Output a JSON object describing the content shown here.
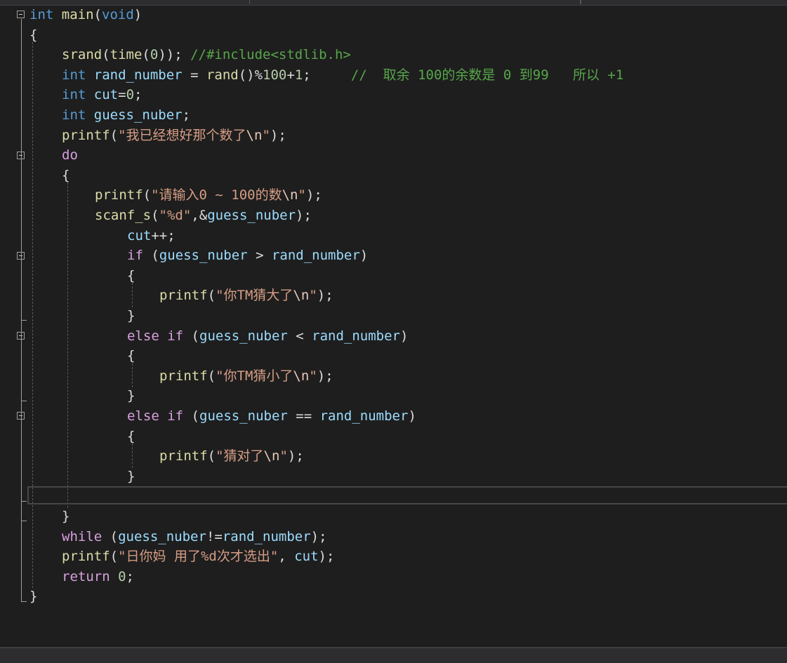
{
  "editor": {
    "lines": [
      [
        {
          "t": "int",
          "c": "kw"
        },
        {
          "t": " "
        },
        {
          "t": "main",
          "c": "fn"
        },
        {
          "t": "("
        },
        {
          "t": "void",
          "c": "kw"
        },
        {
          "t": ")"
        }
      ],
      [
        {
          "t": "{"
        }
      ],
      [
        {
          "t": "srand",
          "c": "fn"
        },
        {
          "t": "("
        },
        {
          "t": "time",
          "c": "fn"
        },
        {
          "t": "("
        },
        {
          "t": "0",
          "c": "num"
        },
        {
          "t": ")); "
        },
        {
          "t": "//#include<stdlib.h>",
          "c": "cmt"
        }
      ],
      [
        {
          "t": "int",
          "c": "kw"
        },
        {
          "t": " "
        },
        {
          "t": "rand_number",
          "c": "var"
        },
        {
          "t": " = "
        },
        {
          "t": "rand",
          "c": "fn"
        },
        {
          "t": "()%"
        },
        {
          "t": "100",
          "c": "num"
        },
        {
          "t": "+"
        },
        {
          "t": "1",
          "c": "num"
        },
        {
          "t": ";     "
        },
        {
          "t": "//  取余 100的余数是 0 到99   所以 +1",
          "c": "cmt"
        }
      ],
      [
        {
          "t": "int",
          "c": "kw"
        },
        {
          "t": " "
        },
        {
          "t": "cut",
          "c": "var"
        },
        {
          "t": "="
        },
        {
          "t": "0",
          "c": "num"
        },
        {
          "t": ";"
        }
      ],
      [
        {
          "t": "int",
          "c": "kw"
        },
        {
          "t": " "
        },
        {
          "t": "guess_nuber",
          "c": "var"
        },
        {
          "t": ";"
        }
      ],
      [
        {
          "t": "printf",
          "c": "fn"
        },
        {
          "t": "("
        },
        {
          "t": "\"我已经想好那个数了",
          "c": "str"
        },
        {
          "t": "\\n",
          "c": "esc"
        },
        {
          "t": "\"",
          "c": "str"
        },
        {
          "t": ");"
        }
      ],
      [
        {
          "t": "do",
          "c": "kw2"
        }
      ],
      [
        {
          "t": "{"
        }
      ],
      [
        {
          "t": "printf",
          "c": "fn"
        },
        {
          "t": "("
        },
        {
          "t": "\"请输入0 ~ 100的数",
          "c": "str"
        },
        {
          "t": "\\n",
          "c": "esc"
        },
        {
          "t": "\"",
          "c": "str"
        },
        {
          "t": ");"
        }
      ],
      [
        {
          "t": "scanf_s",
          "c": "fn"
        },
        {
          "t": "("
        },
        {
          "t": "\"%d\"",
          "c": "str"
        },
        {
          "t": ",&"
        },
        {
          "t": "guess_nuber",
          "c": "var"
        },
        {
          "t": ");"
        }
      ],
      [
        {
          "t": "cut",
          "c": "var"
        },
        {
          "t": "++;"
        }
      ],
      [
        {
          "t": "if",
          "c": "kw2"
        },
        {
          "t": " ("
        },
        {
          "t": "guess_nuber",
          "c": "var"
        },
        {
          "t": " > "
        },
        {
          "t": "rand_number",
          "c": "var"
        },
        {
          "t": ")"
        }
      ],
      [
        {
          "t": "{"
        }
      ],
      [
        {
          "t": "printf",
          "c": "fn"
        },
        {
          "t": "("
        },
        {
          "t": "\"你TM猜大了",
          "c": "str"
        },
        {
          "t": "\\n",
          "c": "esc"
        },
        {
          "t": "\"",
          "c": "str"
        },
        {
          "t": ");"
        }
      ],
      [
        {
          "t": "}"
        }
      ],
      [
        {
          "t": "else",
          "c": "kw2"
        },
        {
          "t": " "
        },
        {
          "t": "if",
          "c": "kw2"
        },
        {
          "t": " ("
        },
        {
          "t": "guess_nuber",
          "c": "var"
        },
        {
          "t": " < "
        },
        {
          "t": "rand_number",
          "c": "var"
        },
        {
          "t": ")"
        }
      ],
      [
        {
          "t": "{"
        }
      ],
      [
        {
          "t": "printf",
          "c": "fn"
        },
        {
          "t": "("
        },
        {
          "t": "\"你TM猜小了",
          "c": "str"
        },
        {
          "t": "\\n",
          "c": "esc"
        },
        {
          "t": "\"",
          "c": "str"
        },
        {
          "t": ");"
        }
      ],
      [
        {
          "t": "}"
        }
      ],
      [
        {
          "t": "else",
          "c": "kw2"
        },
        {
          "t": " "
        },
        {
          "t": "if",
          "c": "kw2"
        },
        {
          "t": " ("
        },
        {
          "t": "guess_nuber",
          "c": "var"
        },
        {
          "t": " == "
        },
        {
          "t": "rand_number",
          "c": "var"
        },
        {
          "t": ")"
        }
      ],
      [
        {
          "t": "{"
        }
      ],
      [
        {
          "t": "printf",
          "c": "fn"
        },
        {
          "t": "("
        },
        {
          "t": "\"猜对了",
          "c": "str"
        },
        {
          "t": "\\n",
          "c": "esc"
        },
        {
          "t": "\"",
          "c": "str"
        },
        {
          "t": ");"
        }
      ],
      [
        {
          "t": "}"
        }
      ],
      [],
      [
        {
          "t": "}"
        }
      ],
      [
        {
          "t": "while",
          "c": "kw2"
        },
        {
          "t": " ("
        },
        {
          "t": "guess_nuber",
          "c": "var"
        },
        {
          "t": "!="
        },
        {
          "t": "rand_number",
          "c": "var"
        },
        {
          "t": ");"
        }
      ],
      [
        {
          "t": "printf",
          "c": "fn"
        },
        {
          "t": "("
        },
        {
          "t": "\"日你妈 用了%d次才选出\"",
          "c": "str"
        },
        {
          "t": ", "
        },
        {
          "t": "cut",
          "c": "var"
        },
        {
          "t": ");"
        }
      ],
      [
        {
          "t": "return",
          "c": "kw2"
        },
        {
          "t": " "
        },
        {
          "t": "0",
          "c": "num"
        },
        {
          "t": ";"
        }
      ],
      [
        {
          "t": "}"
        }
      ]
    ]
  }
}
